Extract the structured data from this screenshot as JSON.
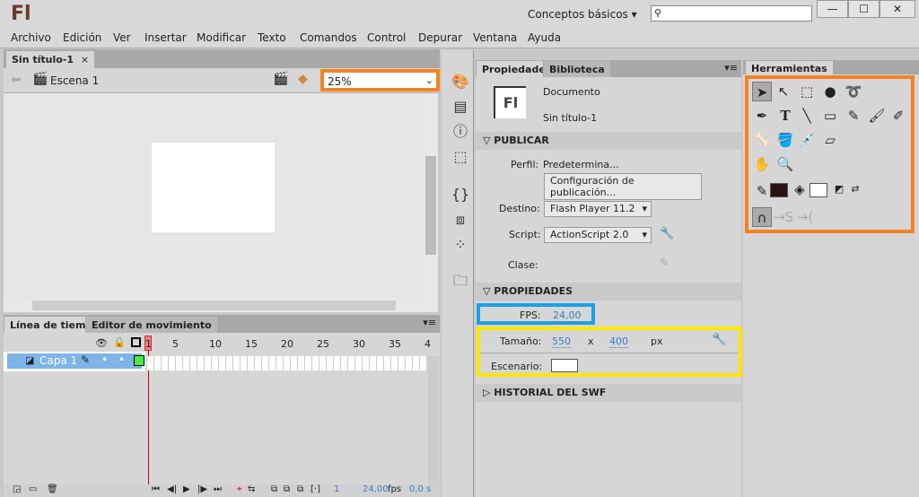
{
  "app": {
    "logo": "Fl",
    "workspace": "Conceptos básicos",
    "search_value": "",
    "window_buttons": [
      "—",
      "☐",
      "✕"
    ]
  },
  "menu": [
    "Archivo",
    "Edición",
    "Ver",
    "Insertar",
    "Modificar",
    "Texto",
    "Comandos",
    "Control",
    "Depurar",
    "Ventana",
    "Ayuda"
  ],
  "document": {
    "tab": "Sin título-1",
    "close": "×",
    "scene": "Escena 1",
    "zoom": "25%"
  },
  "timeline": {
    "tabs": [
      "Línea de tiempo",
      "Editor de movimiento"
    ],
    "ruler": [
      "1",
      "5",
      "10",
      "15",
      "20",
      "25",
      "30",
      "35",
      "4"
    ],
    "layer": "Capa 1",
    "layer_color": "#44ee44",
    "current_frame": "1",
    "fps": "24,00",
    "fps_unit": "fps",
    "time": "0,0 s"
  },
  "properties": {
    "tabs": [
      "Propiedades",
      "Biblioteca"
    ],
    "doc_icon": "Fl",
    "doc_type": "Documento",
    "doc_name": "Sin título-1",
    "publish": {
      "header": "PUBLICAR",
      "profile_label": "Perfil:",
      "profile": "Predetermina...",
      "settings_button": "Configuración de publicación...",
      "target_label": "Destino:",
      "target": "Flash Player 11.2",
      "script_label": "Script:",
      "script": "ActionScript 2.0",
      "class_label": "Clase:"
    },
    "props": {
      "header": "PROPIEDADES",
      "fps_label": "FPS:",
      "fps": "24,00",
      "size_label": "Tamaño:",
      "width": "550",
      "x": "x",
      "height": "400",
      "unit": "px",
      "stage_label": "Escenario:",
      "stage_color": "#ffffff"
    },
    "history": {
      "header": "HISTORIAL DEL SWF"
    }
  },
  "tools": {
    "title": "Herramientas",
    "stroke_color": "#2a1212",
    "fill_color": "#ffffff"
  },
  "colors": {
    "highlight_orange": "#f58220",
    "highlight_blue": "#1ba1e2",
    "highlight_yellow": "#ffe600"
  }
}
